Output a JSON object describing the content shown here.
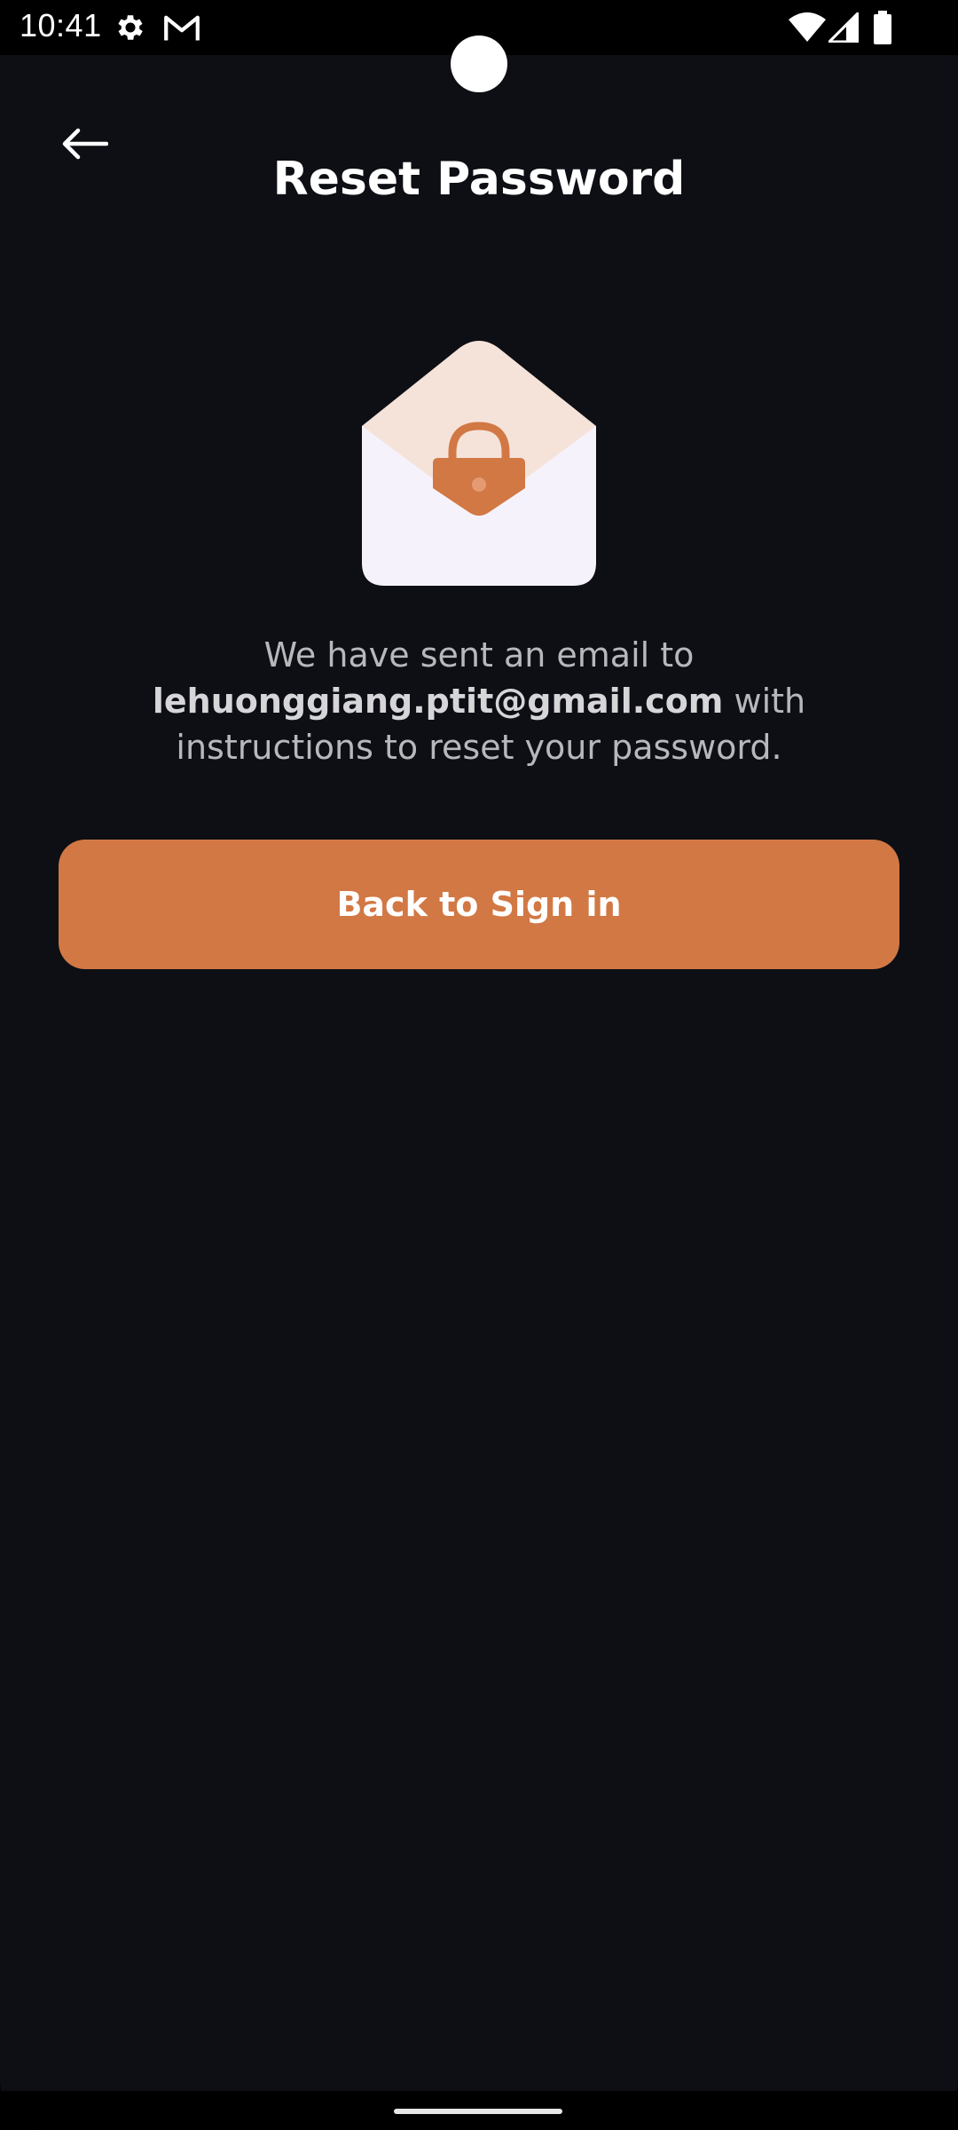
{
  "status_bar": {
    "time": "10:41",
    "left_icons": [
      "gear-icon",
      "gmail-icon"
    ],
    "right_icons": [
      "wifi-icon",
      "signal-icon",
      "battery-icon"
    ]
  },
  "header": {
    "back_icon": "arrow-left-icon",
    "title": "Reset Password"
  },
  "illustration": {
    "icon": "envelope-lock-icon",
    "colors": {
      "envelope": "#f5f2fb",
      "flap": "#f5e3da",
      "lock": "#d27844"
    }
  },
  "message": {
    "prefix": "We have sent an email to",
    "email": "lehuonggiang.ptit@gmail.com",
    "suffix": "with instructions to reset your password."
  },
  "actions": {
    "back_to_sign_in_label": "Back to Sign in"
  },
  "theme": {
    "background": "#0d0f14",
    "accent": "#d27844",
    "text_primary": "#ffffff",
    "text_secondary": "#b8b8bc"
  }
}
